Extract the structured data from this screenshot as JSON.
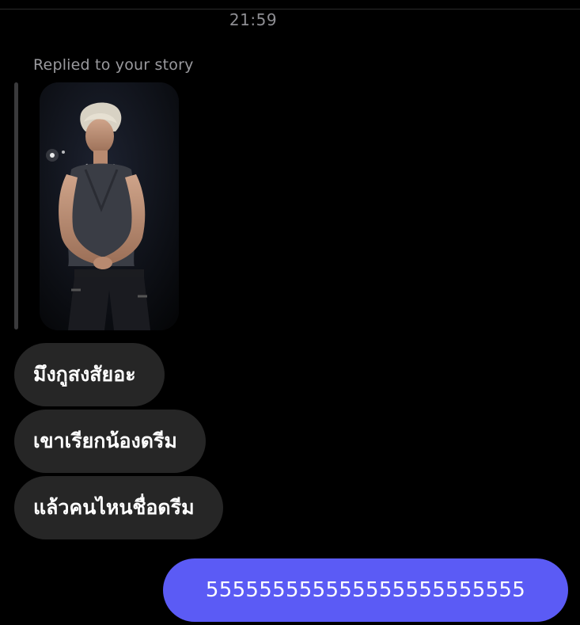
{
  "status": {
    "time": "21:59"
  },
  "story_reply": {
    "label": "Replied to your story",
    "thumbnail_icon": "story-photo-person-on-stage"
  },
  "messages": [
    {
      "side": "received",
      "text": "มึงกูสงสัยอะ"
    },
    {
      "side": "received",
      "text": "เขาเรียกน้องดรีม"
    },
    {
      "side": "received",
      "text": "แล้วคนไหนชื่อดรีม"
    },
    {
      "side": "sent",
      "text": "555555555555555555555555"
    }
  ],
  "colors": {
    "background": "#000000",
    "received_bubble": "#262626",
    "sent_bubble": "#5b5bf5",
    "muted_text": "#8e8e93"
  }
}
